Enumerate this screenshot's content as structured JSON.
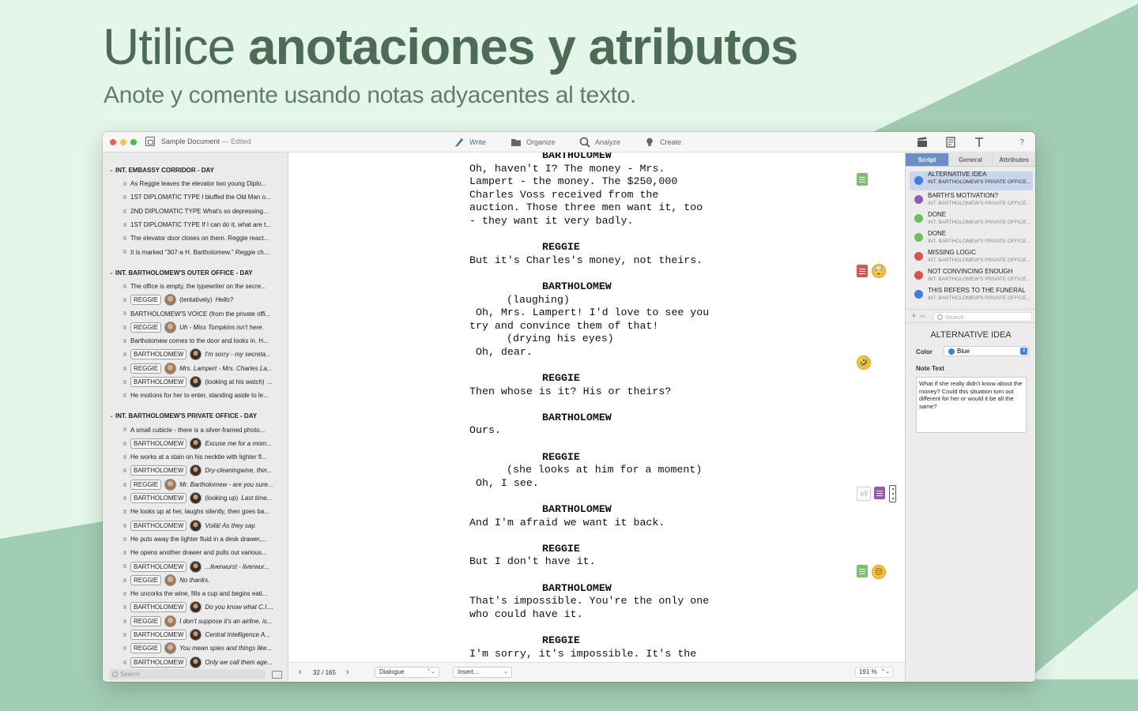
{
  "promo": {
    "headline_light": "Utilice ",
    "headline_bold": "anotaciones y atributos",
    "subhead": "Anote y comente usando notas adyacentes al texto."
  },
  "colors": {
    "accent": "#3c6ea7",
    "background": "#e4f5ea",
    "shape": "#a1cdb3"
  },
  "window": {
    "title": "Sample Document",
    "edited": " — Edited",
    "toolbar": [
      {
        "label": "Write",
        "icon": "pen-icon"
      },
      {
        "label": "Organize",
        "icon": "folder-icon"
      },
      {
        "label": "Analyze",
        "icon": "magnifier-icon"
      },
      {
        "label": "Create",
        "icon": "lightbulb-icon"
      }
    ],
    "help": "?"
  },
  "sidebar": {
    "scenes": [
      {
        "heading": "INT. EMBASSY CORRIDOR - DAY",
        "rows": [
          {
            "text": "As Reggie leaves the elevator two young Diplo..."
          },
          {
            "text": "1ST DIPLOMATIC TYPE I bluffed the Old Man o..."
          },
          {
            "text": "2ND DIPLOMATIC TYPE What's so depressing..."
          },
          {
            "text": "1ST DIPLOMATIC TYPE If I can do it, what are t..."
          },
          {
            "text": "The elevator door closes on them. Reggie react..."
          },
          {
            "text": "It is marked \"307-a H. Bartholomew.\" Reggie ch..."
          }
        ]
      },
      {
        "heading": "INT. BARTHOLOMEW'S OUTER OFFICE - DAY",
        "rows": [
          {
            "text": "The office is empty, the typewriter on the secre..."
          },
          {
            "tag": "REGGIE",
            "av": "r",
            "pre": "(tentatively)",
            "it": "Hello?"
          },
          {
            "text": "BARTHOLOMEW'S VOICE  (from the private offi..."
          },
          {
            "tag": "REGGIE",
            "av": "r",
            "it": "Uh - Miss Tompkins isn't here."
          },
          {
            "text": "Bartholomew comes to the door and looks in. H..."
          },
          {
            "tag": "BARTHOLOMEW",
            "av": "b",
            "it": "I'm sorry - my secreta..."
          },
          {
            "tag": "REGGIE",
            "av": "r",
            "it": "Mrs. Lampert - Mrs. Charles La..."
          },
          {
            "tag": "BARTHOLOMEW",
            "av": "b",
            "pre": "(looking at his watch)",
            "it": "..."
          },
          {
            "text": "He motions for her to enter, standing aside to le..."
          }
        ]
      },
      {
        "heading": "INT. BARTHOLOMEW'S PRIVATE OFFICE - DAY",
        "rows": [
          {
            "text": "A small cubicle - there is a silver-framed photo..."
          },
          {
            "tag": "BARTHOLOMEW",
            "av": "b",
            "it": "Excuse me for a mom..."
          },
          {
            "text": "He works at a stain on his necktie with lighter fl..."
          },
          {
            "tag": "BARTHOLOMEW",
            "av": "b",
            "it": "Dry-cleaningwise, thin..."
          },
          {
            "tag": "REGGIE",
            "av": "r",
            "it": "Mr. Bartholomew - are you sure..."
          },
          {
            "tag": "BARTHOLOMEW",
            "av": "b",
            "pre": "(looking up)",
            "it": "Last time..."
          },
          {
            "text": "He looks up at her, laughs silently, then goes ba..."
          },
          {
            "tag": "BARTHOLOMEW",
            "av": "b",
            "it": "Voilà! As they say."
          },
          {
            "text": "He puts away the lighter fluid in a desk drawer,..."
          },
          {
            "text": "He opens another drawer and pulls out various..."
          },
          {
            "tag": "BARTHOLOMEW",
            "av": "b",
            "it": "...liverwurst - liverwur..."
          },
          {
            "tag": "REGGIE",
            "av": "r",
            "it": "No thanks."
          },
          {
            "text": "He uncorks the wine, fills a cup and begins eati..."
          },
          {
            "tag": "BARTHOLOMEW",
            "av": "b",
            "it": "Do you know what C.I...."
          },
          {
            "tag": "REGGIE",
            "av": "r",
            "it": "I don't suppose it's an airline, is..."
          },
          {
            "tag": "BARTHOLOMEW",
            "av": "b",
            "it": "Central Intelligence A..."
          },
          {
            "tag": "REGGIE",
            "av": "r",
            "it": "You mean spies and things like..."
          },
          {
            "tag": "BARTHOLOMEW",
            "av": "b",
            "it": "Only we call them age..."
          }
        ]
      }
    ],
    "search_placeholder": "Search"
  },
  "script": [
    {
      "char": "BARTHOLOMEW",
      "dialogue": "Oh, haven't I? The money - Mrs.\nLampert - the money. The $250,000\nCharles Voss received from the\nauction. Those three men want it, too\n- they want it very badly."
    },
    {
      "char": "REGGIE",
      "dialogue": "But it's Charles's money, not theirs."
    },
    {
      "char": "BARTHOLOMEW",
      "paren1": "(laughing)",
      "dialogue": " Oh, Mrs. Lampert! I'd love to see you\ntry and convince them of that!",
      "paren2": "(drying his eyes)",
      "dialogue2": " Oh, dear."
    },
    {
      "char": "REGGIE",
      "dialogue": "Then whose is it? His or theirs?"
    },
    {
      "char": "BARTHOLOMEW",
      "dialogue": "Ours."
    },
    {
      "char": "REGGIE",
      "paren1": "(she looks at him for a moment)",
      "dialogue": " Oh, I see."
    },
    {
      "char": "BARTHOLOMEW",
      "dialogue": "And I'm afraid we want it back."
    },
    {
      "char": "REGGIE",
      "dialogue": "But I don't have it."
    },
    {
      "char": "BARTHOLOMEW",
      "dialogue": "That's impossible. You're the only one\nwho could have it."
    },
    {
      "char": "REGGIE",
      "dialogue": "I'm sorry, it's impossible. It's the"
    }
  ],
  "annotations": {
    "emoji_1": "🤯",
    "emoji_2": "🤣",
    "emoji_3": "😔",
    "pager": "1/2"
  },
  "status": {
    "page": "32 / 165",
    "element": "Dialogue",
    "insert": "Insert...",
    "zoom": "191 %"
  },
  "inspector": {
    "tabs": [
      "Script",
      "General",
      "Attributes"
    ],
    "notes": [
      {
        "title": "ALTERNATIVE IDEA",
        "sub": "INT. BARTHOLOMEW'S PRIVATE OFFICE...",
        "color": "#3f7fe0"
      },
      {
        "title": "BARTH'S MOTIVATION?",
        "sub": "INT. BARTHOLOMEW'S PRIVATE OFFICE...",
        "color": "#9b59b6"
      },
      {
        "title": "DONE",
        "sub": "INT. BARTHOLOMEW'S PRIVATE OFFICE...",
        "color": "#6cbf5a"
      },
      {
        "title": "DONE",
        "sub": "INT. BARTHOLOMEW'S PRIVATE OFFICE...",
        "color": "#6cbf5a"
      },
      {
        "title": "MISSING LOGIC",
        "sub": "INT. BARTHOLOMEW'S PRIVATE OFFICE...",
        "color": "#d9534f"
      },
      {
        "title": "NOT CONVINCING ENOUGH",
        "sub": "INT. BARTHOLOMEW'S PRIVATE OFFICE...",
        "color": "#d9534f"
      },
      {
        "title": "THIS REFERS TO THE FUNERAL",
        "sub": "INT. BARTHOLOMEW'S PRIVATE OFFICE...",
        "color": "#3f7fe0"
      }
    ],
    "search_placeholder": "Search",
    "detail_title": "ALTERNATIVE IDEA",
    "color_label": "Color",
    "color_value": "Blue",
    "note_text_label": "Note Text",
    "note_text": "What if she really didn't know about the money? Could this situation turn out different for her or would it be all the same?"
  }
}
